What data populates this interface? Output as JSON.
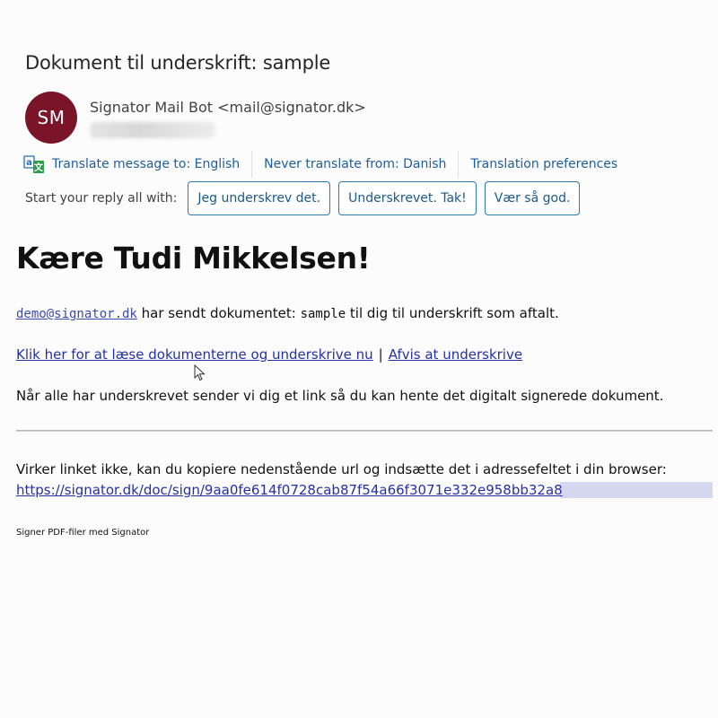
{
  "email": {
    "subject": "Dokument til underskrift: sample",
    "avatar_initials": "SM",
    "avatar_color": "#7a1529",
    "sender": "Signator Mail Bot <mail@signator.dk>"
  },
  "translation_bar": {
    "icon": "translate-icon",
    "translate_label": "Translate message to: English",
    "never_translate_label": "Never translate from: Danish",
    "preferences_label": "Translation preferences"
  },
  "reply_all": {
    "label": "Start your reply all with:",
    "suggestions": [
      "Jeg underskrev det.",
      "Underskrevet. Tak!",
      "Vær så god."
    ]
  },
  "body": {
    "greeting": "Kære Tudi Mikkelsen!",
    "sender_email": "demo@signator.dk",
    "sent_text_1": " har sendt dokumentet: ",
    "document_name": "sample",
    "sent_text_2": " til dig til underskrift som aftalt.",
    "sign_link": "Klik her for at læse dokumenterne og underskrive nu",
    "separator": "|",
    "reject_link": "Afvis at underskrive",
    "info_text": "Når alle har underskrevet sender vi dig et link så du kan hente det digitalt signerede dokument.",
    "fallback_text": "Virker linket ikke, kan du kopiere nedenstående url og indsætte det i adressefeltet i din browser:",
    "sign_url": "https://signator.dk/doc/sign/9aa0fe614f0728cab87f54a66f3071e332e958bb32a8",
    "footer": "Signer PDF-filer med Signator"
  },
  "colors": {
    "link": "#2530a8",
    "translate_link": "#1f5e9c",
    "reply_border": "#2b7db5"
  }
}
